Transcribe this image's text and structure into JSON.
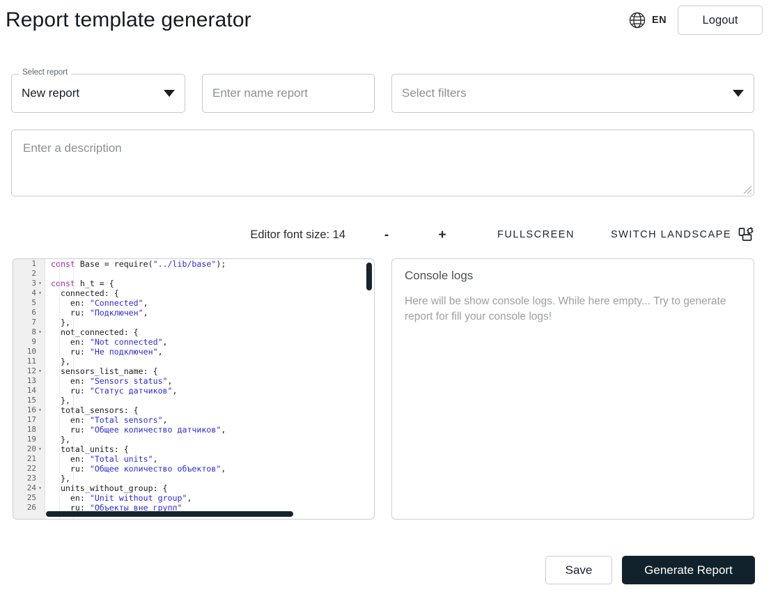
{
  "header": {
    "title": "Report template generator",
    "language": "EN",
    "globe_icon": "globe-icon",
    "logout_label": "Logout"
  },
  "form": {
    "select_report": {
      "legend": "Select report",
      "value": "New report",
      "caret_icon": "chevron-down-icon"
    },
    "name_report": {
      "placeholder": "Enter name report",
      "value": ""
    },
    "filters": {
      "placeholder": "Select filters",
      "value": "",
      "caret_icon": "chevron-down-icon"
    },
    "description": {
      "placeholder": "Enter a description",
      "value": "",
      "resize_handle_icon": "resize-grip-icon"
    }
  },
  "editor_toolbar": {
    "font_size_label": "Editor font size: 14",
    "font_size_value": 14,
    "decrease_label": "-",
    "increase_label": "+",
    "fullscreen_label": "FULLSCREEN",
    "switch_landscape_label": "SWITCH LANDSCAPE",
    "switch_landscape_icon": "screen-rotation-icon"
  },
  "editor": {
    "line_numbers": [
      1,
      2,
      3,
      4,
      5,
      6,
      7,
      8,
      9,
      10,
      11,
      12,
      13,
      14,
      15,
      16,
      17,
      18,
      19,
      20,
      21,
      22,
      23,
      24,
      25,
      26
    ],
    "folded_lines": [
      3,
      4,
      8,
      12,
      16,
      20,
      24
    ],
    "fold_glyph": "▾",
    "lines": [
      "const Base = require(\"../lib/base\");",
      "",
      "const h_t = {",
      "  connected: {",
      "    en: \"Connected\",",
      "    ru: \"Подключен\",",
      "  },",
      "  not_connected: {",
      "    en: \"Not connected\",",
      "    ru: \"Не подключен\",",
      "  },",
      "  sensors_list_name: {",
      "    en: \"Sensors status\",",
      "    ru: \"Статус датчиков\",",
      "  },",
      "  total_sensors: {",
      "    en: \"Total sensors\",",
      "    ru: \"Общее количество датчиков\",",
      "  },",
      "  total_units: {",
      "    en: \"Total units\",",
      "    ru: \"Общее количество объектов\",",
      "  },",
      "  units_without_group: {",
      "    en: \"Unit without group\",",
      "    ru: \"Объекты вне групп\""
    ],
    "colors": {
      "keyword": "#a626a4",
      "string": "#2a2ae0",
      "text": "#1b1b1b",
      "gutter_bg": "#f0f0f0",
      "scrollbar": "#15242d"
    }
  },
  "console": {
    "title": "Console logs",
    "empty_message": "Here will be show console logs. While here empty... Try to generate report for fill your console logs!"
  },
  "footer": {
    "save_label": "Save",
    "generate_label": "Generate Report",
    "generate_bg": "#12222c"
  }
}
